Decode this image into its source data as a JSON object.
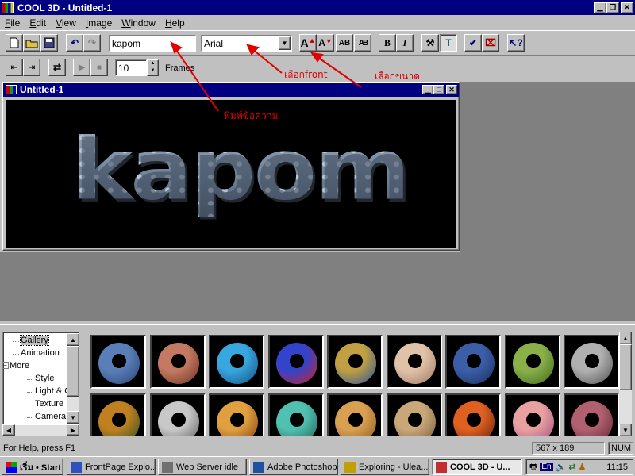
{
  "app": {
    "title": "COOL 3D - Untitled-1",
    "menus": [
      {
        "label": "File",
        "ul": "F",
        "rest": "ile"
      },
      {
        "label": "Edit",
        "ul": "E",
        "rest": "dit"
      },
      {
        "label": "View",
        "ul": "V",
        "rest": "iew"
      },
      {
        "label": "Image",
        "ul": "I",
        "rest": "mage"
      },
      {
        "label": "Window",
        "ul": "W",
        "rest": "indow"
      },
      {
        "label": "Help",
        "ul": "H",
        "rest": "elp"
      }
    ]
  },
  "toolbar": {
    "text_input_value": "kapom",
    "font_select_value": "Arial",
    "bold_label": "B",
    "italic_label": "I",
    "frame_value": "10",
    "frames_label": "Frames"
  },
  "annotations": {
    "type_text": "พิมพ์ข้อความ",
    "choose_font": "เลือกfront",
    "choose_size": "เลือกขนาด"
  },
  "document": {
    "title": "Untitled-1",
    "canvas_text": "kapom"
  },
  "gallery": {
    "tree": [
      {
        "label": "Gallery",
        "selected": true
      },
      {
        "label": "Animation"
      },
      {
        "label": "More",
        "expanded": true
      },
      {
        "label": "Style"
      },
      {
        "label": "Light & C"
      },
      {
        "label": "Texture"
      },
      {
        "label": "Camera"
      }
    ],
    "thumbnails_row1": [
      {
        "name": "blue-bubbles-texture",
        "color": "#5a7fb8",
        "color2": "#2b4377"
      },
      {
        "name": "copper-texture",
        "color": "#c47a62",
        "color2": "#6b3222"
      },
      {
        "name": "aqua-texture",
        "color": "#38a6df",
        "color2": "#11507f"
      },
      {
        "name": "blue-red-texture",
        "color": "#3344cc",
        "color2": "#cc2222"
      },
      {
        "name": "mosaic-texture",
        "color": "#c0a040",
        "color2": "#2a4fa0"
      },
      {
        "name": "speckled-stone-texture",
        "color": "#e0c2a8",
        "color2": "#a07860"
      },
      {
        "name": "denim-texture",
        "color": "#3a5fa8",
        "color2": "#1a2f60"
      },
      {
        "name": "green-moss-texture",
        "color": "#8ab04a",
        "color2": "#3f6a1a"
      },
      {
        "name": "grey-marble-texture",
        "color": "#b0b0b0",
        "color2": "#505050"
      }
    ],
    "thumbnails_row2": [
      {
        "name": "tiger-texture",
        "color": "#c08020",
        "color2": "#2a5020"
      },
      {
        "name": "chrome-texture",
        "color": "#c8c8c8",
        "color2": "#606060"
      },
      {
        "name": "gold-texture",
        "color": "#e0a040",
        "color2": "#804010"
      },
      {
        "name": "turquoise-texture",
        "color": "#50c0b0",
        "color2": "#206058"
      },
      {
        "name": "wood-texture",
        "color": "#d8a050",
        "color2": "#8a5a20"
      },
      {
        "name": "sand-texture",
        "color": "#c8a878",
        "color2": "#7a5a38"
      },
      {
        "name": "fire-texture",
        "color": "#e06020",
        "color2": "#602010"
      },
      {
        "name": "pastel-texture",
        "color": "#e8a0a0",
        "color2": "#a05080"
      },
      {
        "name": "granite-red-texture",
        "color": "#b06070",
        "color2": "#602830"
      }
    ]
  },
  "status": {
    "help_text": "For Help, press F1",
    "dimensions": "567 x 189",
    "num": "NUM"
  },
  "taskbar": {
    "start_label": "เริ่ม • Start",
    "tasks": [
      {
        "label": "FrontPage Explo...",
        "icon_color": "#3050c0"
      },
      {
        "label": "Web Server idle",
        "icon_color": "#707070"
      },
      {
        "label": "Adobe Photoshop",
        "icon_color": "#2050a0"
      },
      {
        "label": "Exploring - Ulea...",
        "icon_color": "#c0a000"
      },
      {
        "label": "COOL 3D - U...",
        "icon_color": "#c03030",
        "active": true
      }
    ],
    "tray_lang": "En",
    "clock": "11:15"
  }
}
